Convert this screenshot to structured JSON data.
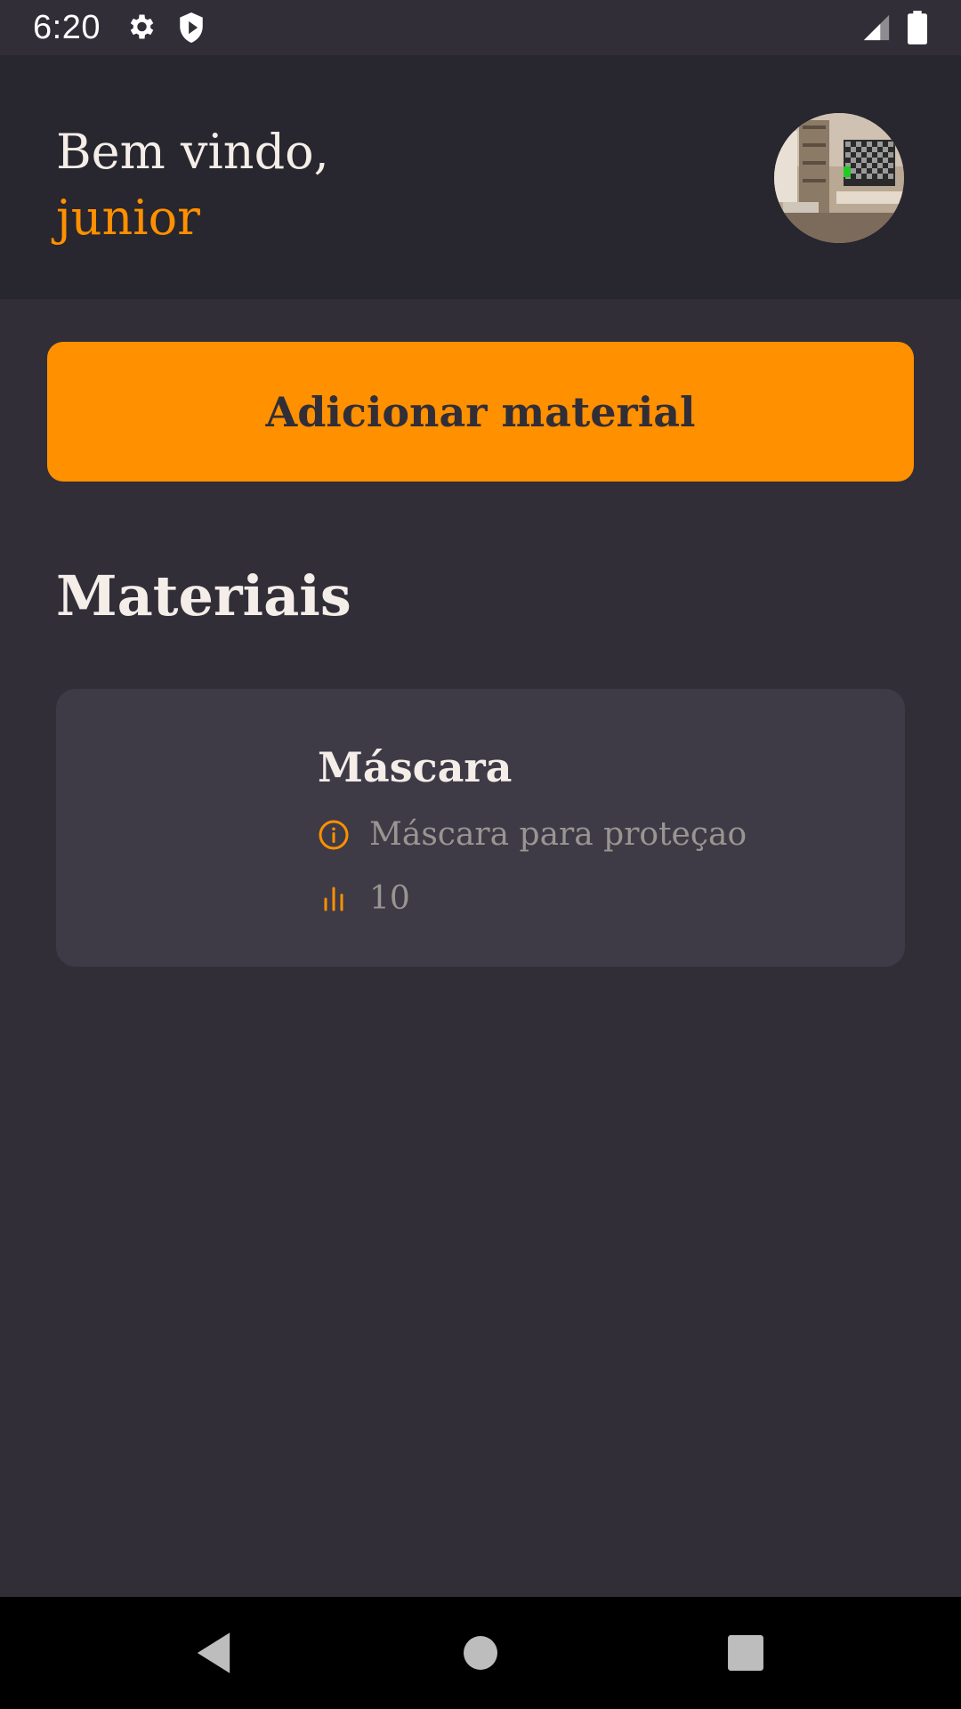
{
  "status_bar": {
    "time": "6:20",
    "icons": [
      "gear-icon",
      "shield-play-icon",
      "signal-icon",
      "battery-icon"
    ]
  },
  "header": {
    "greeting": "Bem vindo,",
    "username": "junior"
  },
  "actions": {
    "add_material_label": "Adicionar material"
  },
  "section": {
    "title": "Materiais"
  },
  "materials": [
    {
      "name": "Máscara",
      "description": "Máscara para proteçao",
      "quantity": "10"
    }
  ],
  "nav": {
    "back_icon": "back-triangle-icon",
    "home_icon": "home-circle-icon",
    "recents_icon": "recents-square-icon"
  },
  "colors": {
    "background": "#312e38",
    "header": "#28262e",
    "accent": "#ff9000",
    "card": "#3e3b47",
    "text_primary": "#f4ede8",
    "text_secondary": "#999591"
  }
}
